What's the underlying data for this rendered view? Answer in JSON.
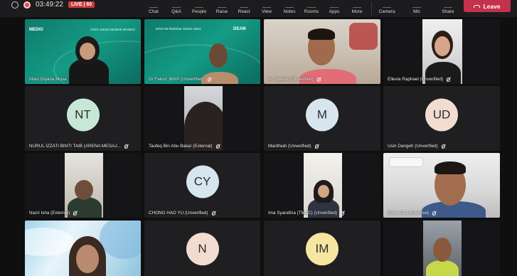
{
  "toolbar": {
    "timer": "03:49:22",
    "live_badge": "LIVE | 60",
    "items": [
      {
        "label": "Chat",
        "icon": "chat-icon"
      },
      {
        "label": "Q&A",
        "icon": "qa-icon"
      },
      {
        "label": "People",
        "icon": "people-icon"
      },
      {
        "label": "Raise",
        "icon": "raise-hand-icon"
      },
      {
        "label": "React",
        "icon": "react-icon"
      },
      {
        "label": "View",
        "icon": "view-icon"
      },
      {
        "label": "Notes",
        "icon": "notes-icon"
      },
      {
        "label": "Rooms",
        "icon": "rooms-icon"
      },
      {
        "label": "Apps",
        "icon": "apps-icon"
      },
      {
        "label": "More",
        "icon": "more-icon"
      },
      {
        "label": "Camera",
        "icon": "camera-icon"
      },
      {
        "label": "Mic",
        "icon": "mic-icon"
      },
      {
        "label": "Share",
        "icon": "share-icon"
      }
    ],
    "leave_label": "Leave",
    "leave_color": "#c4314b"
  },
  "participants": [
    {
      "name": "Intan Diyana Musa",
      "type": "video"
    },
    {
      "name": "Dr Fairuz JKKP (Unverified)",
      "type": "video"
    },
    {
      "name": "Dr. Syamir (Unverified)",
      "type": "video"
    },
    {
      "name": "Ellevia Raphael (Unverified)",
      "type": "video"
    },
    {
      "name": "NURUL IZZATI BINTI TAIB (ARENA MEGAJ...",
      "type": "avatar",
      "initials": "NT"
    },
    {
      "name": "Taufeq Bin Abu Bakar (External)",
      "type": "video"
    },
    {
      "name": "Mardhiah (Unverified)",
      "type": "avatar",
      "initials": "M"
    },
    {
      "name": "Usin Dangeh (Unverified)",
      "type": "avatar",
      "initials": "UD"
    },
    {
      "name": "Nazri Isha (External)",
      "type": "video"
    },
    {
      "name": "CHONG HAO YU (Unverified)",
      "type": "avatar",
      "initials": "CY"
    },
    {
      "name": "Ima Syarafina (TMEC) (Unverified)",
      "type": "video"
    },
    {
      "name": "Eddy Chia (External)",
      "type": "video"
    },
    {
      "name": "",
      "type": "video"
    },
    {
      "name": "",
      "type": "avatar",
      "initials": "N"
    },
    {
      "name": "",
      "type": "avatar",
      "initials": "IM"
    },
    {
      "name": "",
      "type": "video"
    }
  ],
  "video_banners": {
    "tile1_logo": "MEDIO",
    "tile1_text": "AGIS zamat sarabek MASKO",
    "tile2_text": "ERGAM Webinar Series 2024",
    "tile2_logo": "DEAM"
  }
}
